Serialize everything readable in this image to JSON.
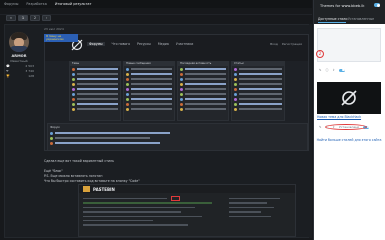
{
  "topnav": {
    "items": [
      "Форумы",
      "Разработка",
      "Итоговый результат"
    ],
    "active_index": 2
  },
  "pager": {
    "prev": "«",
    "pages": [
      "1",
      "2"
    ],
    "next": "›",
    "current": "1"
  },
  "post": {
    "date": "23 июл 2024",
    "user": {
      "name": "ARMOR",
      "role": "Известный",
      "stats": [
        {
          "label": "💬",
          "value": "2 503"
        },
        {
          "label": "❤",
          "value": "3 740"
        },
        {
          "label": "🏆",
          "value": "128"
        }
      ]
    },
    "flag_text": "Я пишу на украинском",
    "text_line1": "Сделал еще вот такой вариантный стиль",
    "text_line2": "Ещё \"блок\"",
    "text_line3": "P.S. Еще можно вставлять логотип",
    "text_line4": "Что бы быстро составить код вставьте на кнопку \"Code\""
  },
  "shot1": {
    "nav": [
      "Форумы",
      "Что нового",
      "Ресурсы",
      "Медиа",
      "Участники"
    ],
    "active_nav": 0,
    "right": [
      "Вход",
      "Регистрация"
    ],
    "columns": [
      "Темы",
      "Новые сообщения",
      "Последняя активность",
      "Статьи"
    ],
    "bottom_title": "Форум"
  },
  "shot2": {
    "brand": "PASTEBIN"
  },
  "right_panel": {
    "title": "Themes for",
    "title_site": "www.bbeb.lk",
    "subtitle": "Доступные стили",
    "tabs": [
      "Доступные стили",
      "Установленные"
    ],
    "marker": "2",
    "card_caption": "Новая тема для BlackHack",
    "card_sub": "Установлено",
    "more_link": "Найти больше стилей для этого сайта",
    "accent": "#5ab0e6",
    "annotation_color": "#e03a3a"
  }
}
